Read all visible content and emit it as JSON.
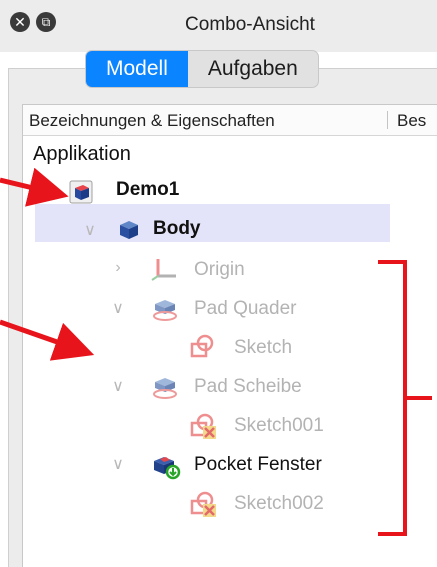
{
  "window": {
    "title": "Combo-Ansicht",
    "close_glyph": "✕",
    "restore_glyph": "⧉"
  },
  "tabs": [
    {
      "label": "Modell",
      "active": true
    },
    {
      "label": "Aufgaben",
      "active": false
    }
  ],
  "tree_header": {
    "col1": "Bezeichnungen & Eigenschaften",
    "col2": "Bes"
  },
  "tree": {
    "root_label": "Applikation",
    "items": [
      {
        "label": "Demo1",
        "icon": "document-icon",
        "bold": true
      },
      {
        "label": "Body",
        "icon": "body-icon",
        "bold": true,
        "selected": true
      },
      {
        "label": "Origin",
        "icon": "origin-axes-icon"
      },
      {
        "label": "Pad Quader",
        "icon": "pad-icon"
      },
      {
        "label": "Sketch",
        "icon": "sketch-icon"
      },
      {
        "label": "Pad Scheibe",
        "icon": "pad-icon"
      },
      {
        "label": "Sketch001",
        "icon": "sketch-warning-icon"
      },
      {
        "label": "Pocket Fenster",
        "icon": "pocket-tip-icon"
      },
      {
        "label": "Sketch002",
        "icon": "sketch-warning-icon"
      }
    ]
  },
  "colors": {
    "accent_tab": "#0a84ff",
    "selection": "#e3e3f9",
    "annotation": "#e8141b"
  }
}
